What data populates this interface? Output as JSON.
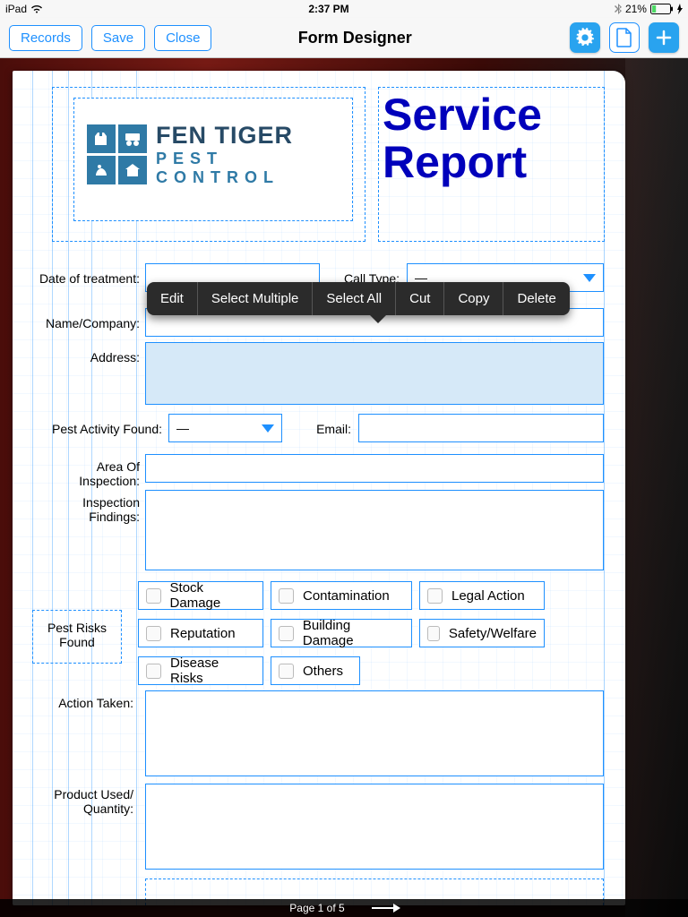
{
  "status": {
    "device": "iPad",
    "time": "2:37 PM",
    "battery": "21%"
  },
  "toolbar": {
    "records": "Records",
    "save": "Save",
    "close": "Close",
    "title": "Form Designer"
  },
  "logo": {
    "line1": "FEN TIGER",
    "line2": "PEST CONTROL"
  },
  "big_title": "Service\nReport",
  "labels": {
    "date_of_treatment": "Date of treatment:",
    "call_type": "Call Type:",
    "name_company": "Name/Company:",
    "address": "Address:",
    "pest_activity": "Pest Activity Found:",
    "email": "Email:",
    "area_of_inspection": "Area Of Inspection:",
    "inspection_findings": "Inspection Findings:",
    "pest_risks_found": "Pest Risks Found",
    "action_taken": "Action Taken:",
    "product_used": "Product Used/ Quantity:"
  },
  "dropdowns": {
    "call_type": {
      "value": "—"
    },
    "pest_activity": {
      "value": "—"
    }
  },
  "risks": {
    "stock_damage": "Stock Damage",
    "contamination": "Contamination",
    "legal_action": "Legal Action",
    "reputation": "Reputation",
    "building_damage": "Building Damage",
    "safety_welfare": "Safety/Welfare",
    "disease_risks": "Disease Risks",
    "others": "Others"
  },
  "context_menu": {
    "edit": "Edit",
    "select_multiple": "Select Multiple",
    "select_all": "Select All",
    "cut": "Cut",
    "copy": "Copy",
    "delete": "Delete"
  },
  "footer": {
    "page": "Page 1 of 5"
  }
}
